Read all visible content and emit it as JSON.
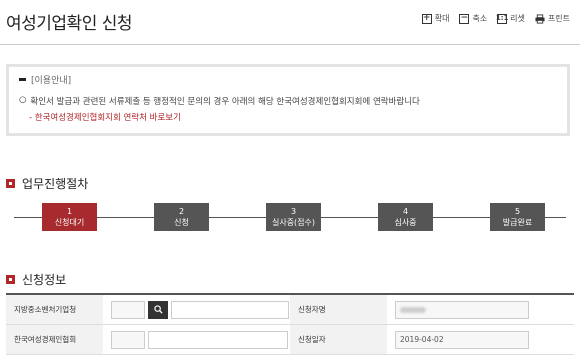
{
  "page": {
    "title": "여성기업확인 신청"
  },
  "toolbar": {
    "zoom_in": "확대",
    "zoom_out": "축소",
    "reset": "리셋",
    "print": "프린트"
  },
  "notice": {
    "title": "[이용안내]",
    "line1_bullet": "○",
    "line1": "확인서 발급과 관련된 서류제출 등 행정적인 문의의 경우 아래의 해당 한국여성경제인협회지회에 연락바랍니다",
    "link": "- 한국여성경제인협회지회 연락처 바로보기"
  },
  "process": {
    "title": "업무진행절차",
    "steps": [
      {
        "num": "1",
        "label": "신청대기",
        "active": true
      },
      {
        "num": "2",
        "label": "신청",
        "active": false
      },
      {
        "num": "3",
        "label": "실사중(접수)",
        "active": false
      },
      {
        "num": "4",
        "label": "심사중",
        "active": false
      },
      {
        "num": "5",
        "label": "발급완료",
        "active": false
      }
    ]
  },
  "application": {
    "title": "신청정보",
    "rows": [
      {
        "label": "지방중소벤처기업청",
        "right_label": "신청자명",
        "right_value": ""
      },
      {
        "label": "한국여성경제인협회",
        "right_label": "신청일자",
        "right_value": "2019-04-02"
      }
    ]
  },
  "colors": {
    "accent": "#a62a2e",
    "step_inactive": "#555555"
  },
  "icons": {
    "zoom_in": "plus-box-icon",
    "zoom_out": "minus-box-icon",
    "reset": "reset-icon",
    "print": "printer-icon",
    "search": "search-icon"
  }
}
